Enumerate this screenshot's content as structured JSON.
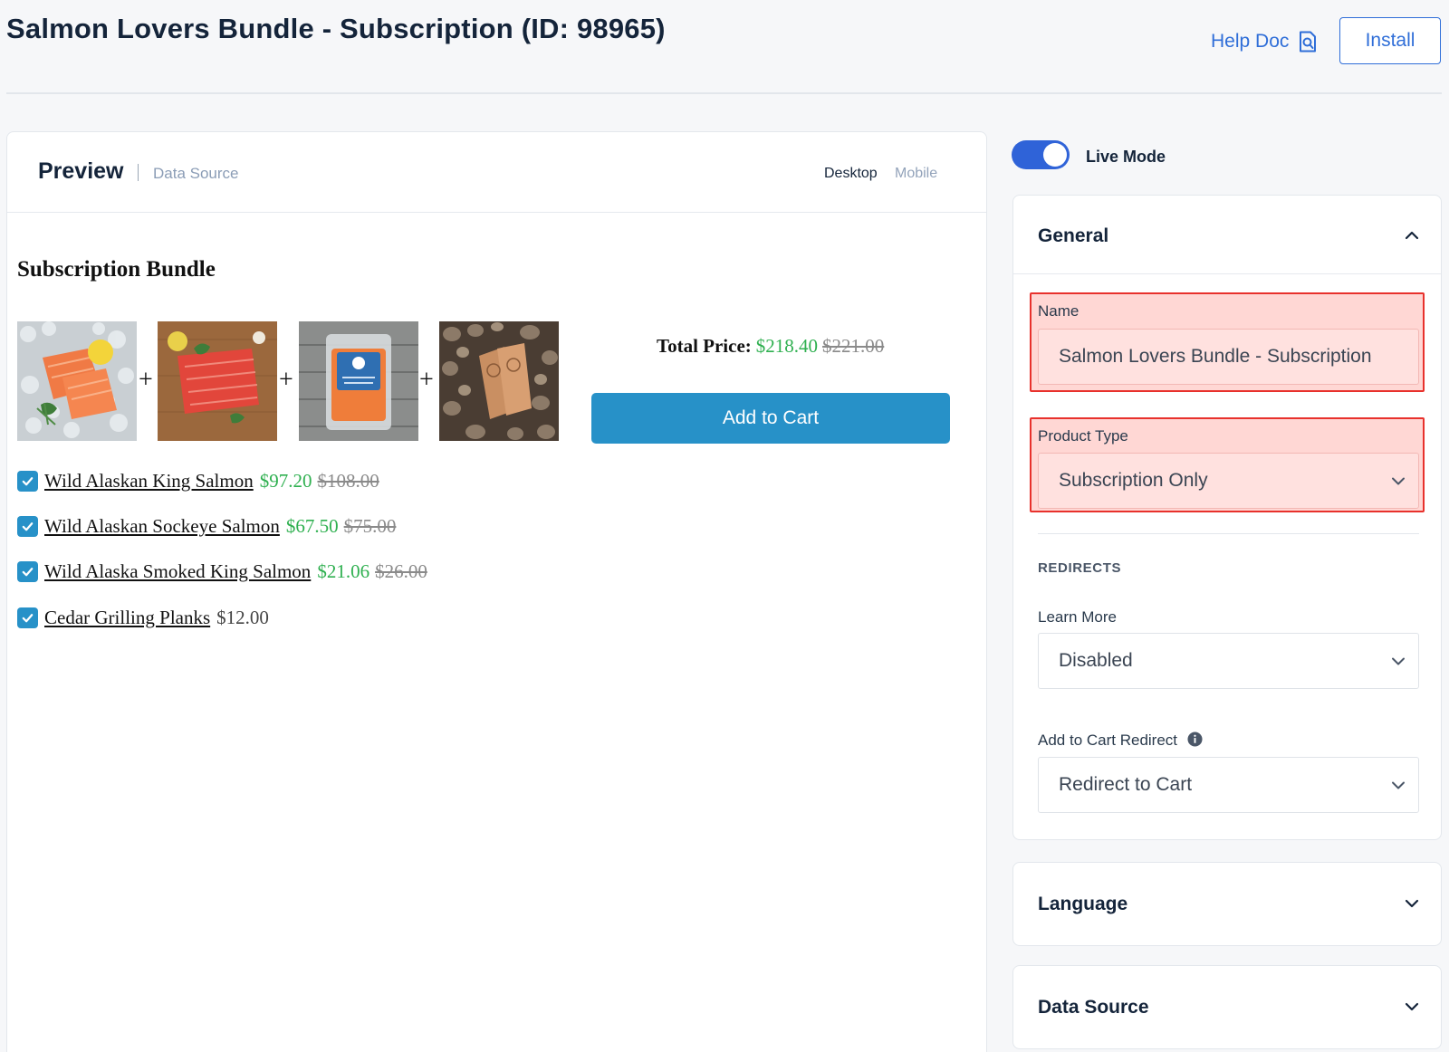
{
  "header": {
    "title": "Salmon Lovers Bundle - Subscription (ID: 98965)",
    "help_label": "Help Doc",
    "install_label": "Install"
  },
  "preview": {
    "title": "Preview",
    "data_source_tab": "Data Source",
    "device_desktop": "Desktop",
    "device_mobile": "Mobile",
    "bundle_title": "Subscription Bundle",
    "total_label": "Total Price:",
    "total_sale": "$218.40",
    "total_original": "$221.00",
    "add_to_cart_label": "Add to Cart",
    "items": [
      {
        "name": "Wild Alaskan King Salmon",
        "sale": "$97.20",
        "original": "$108.00",
        "checked": true
      },
      {
        "name": "Wild Alaskan Sockeye Salmon",
        "sale": "$67.50",
        "original": "$75.00",
        "checked": true
      },
      {
        "name": "Wild Alaska Smoked King Salmon",
        "sale": "$21.06",
        "original": "$26.00",
        "checked": true
      },
      {
        "name": "Cedar Grilling Planks",
        "price": "$12.00",
        "checked": true
      }
    ]
  },
  "settings": {
    "live_mode_label": "Live Mode",
    "live_mode_on": true,
    "general": {
      "title": "General",
      "name_label": "Name",
      "name_value": "Salmon Lovers Bundle - Subscription",
      "product_type_label": "Product Type",
      "product_type_value": "Subscription Only",
      "redirects_caption": "REDIRECTS",
      "learn_more_label": "Learn More",
      "learn_more_value": "Disabled",
      "add_to_cart_redirect_label": "Add to Cart Redirect",
      "add_to_cart_redirect_value": "Redirect to Cart"
    },
    "language_title": "Language",
    "data_source_title": "Data Source"
  },
  "colors": {
    "accent_blue": "#2f6ed8",
    "cart_blue": "#2791c8",
    "sale_green": "#2fb050",
    "highlight_red": "#e8312c"
  }
}
